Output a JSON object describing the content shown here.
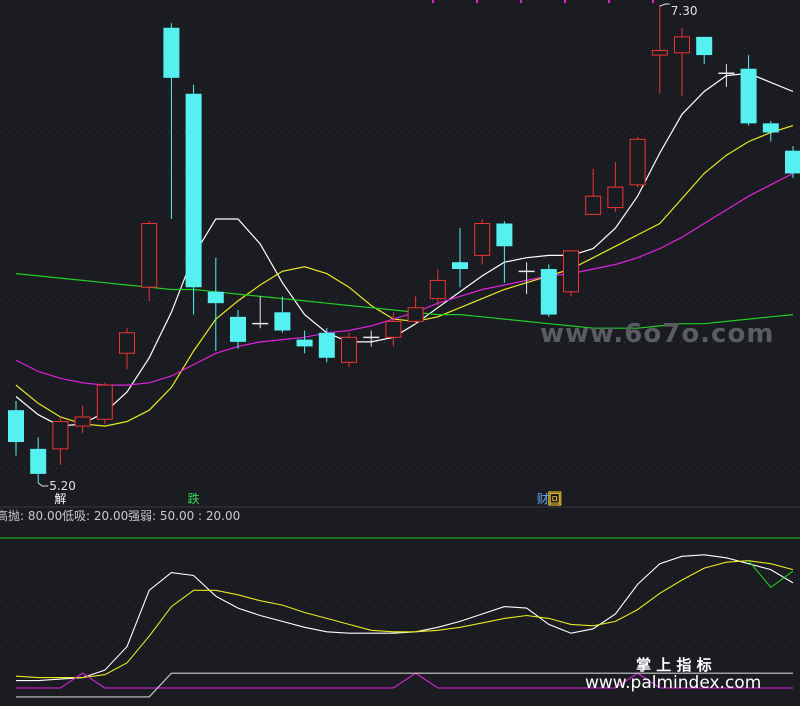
{
  "chart_data": [
    {
      "type": "candlestick",
      "panel": "price",
      "annotations": {
        "high_label": "7.30",
        "low_label": "5.20"
      },
      "event_markers": [
        {
          "index": 2,
          "text": "解"
        },
        {
          "index": 8,
          "text": "跌"
        },
        {
          "index": 24,
          "text": "财"
        },
        {
          "index": 24,
          "text": "回"
        }
      ],
      "candles": [
        {
          "o": 5.52,
          "c": 5.38,
          "h": 5.56,
          "l": 5.32
        },
        {
          "o": 5.35,
          "c": 5.24,
          "h": 5.4,
          "l": 5.2
        },
        {
          "o": 5.35,
          "c": 5.47,
          "h": 5.49,
          "l": 5.28
        },
        {
          "o": 5.45,
          "c": 5.49,
          "h": 5.54,
          "l": 5.42
        },
        {
          "o": 5.48,
          "c": 5.63,
          "h": 5.64,
          "l": 5.46
        },
        {
          "o": 5.77,
          "c": 5.86,
          "h": 5.88,
          "l": 5.7
        },
        {
          "o": 6.06,
          "c": 6.34,
          "h": 6.35,
          "l": 6.0
        },
        {
          "o": 7.2,
          "c": 6.98,
          "h": 7.22,
          "l": 6.36
        },
        {
          "o": 6.91,
          "c": 6.06,
          "h": 6.95,
          "l": 5.94
        },
        {
          "o": 6.04,
          "c": 5.99,
          "h": 6.19,
          "l": 5.78
        },
        {
          "o": 5.93,
          "c": 5.82,
          "h": 5.96,
          "l": 5.79
        },
        {
          "o": 5.9,
          "c": 5.9,
          "h": 6.02,
          "l": 5.88
        },
        {
          "o": 5.95,
          "c": 5.87,
          "h": 6.02,
          "l": 5.86
        },
        {
          "o": 5.83,
          "c": 5.8,
          "h": 5.87,
          "l": 5.77
        },
        {
          "o": 5.86,
          "c": 5.75,
          "h": 5.88,
          "l": 5.73
        },
        {
          "o": 5.73,
          "c": 5.84,
          "h": 5.86,
          "l": 5.71
        },
        {
          "o": 5.84,
          "c": 5.84,
          "h": 5.87,
          "l": 5.8
        },
        {
          "o": 5.84,
          "c": 5.91,
          "h": 5.95,
          "l": 5.8
        },
        {
          "o": 5.91,
          "c": 5.97,
          "h": 6.02,
          "l": 5.9
        },
        {
          "o": 6.01,
          "c": 6.09,
          "h": 6.14,
          "l": 5.98
        },
        {
          "o": 6.17,
          "c": 6.14,
          "h": 6.32,
          "l": 6.06
        },
        {
          "o": 6.2,
          "c": 6.34,
          "h": 6.36,
          "l": 6.16
        },
        {
          "o": 6.34,
          "c": 6.24,
          "h": 6.35,
          "l": 6.08
        },
        {
          "o": 6.13,
          "c": 6.13,
          "h": 6.17,
          "l": 6.03
        },
        {
          "o": 6.14,
          "c": 5.94,
          "h": 6.16,
          "l": 5.93
        },
        {
          "o": 6.04,
          "c": 6.22,
          "h": 6.22,
          "l": 6.02
        },
        {
          "o": 6.38,
          "c": 6.46,
          "h": 6.58,
          "l": 6.38
        },
        {
          "o": 6.41,
          "c": 6.5,
          "h": 6.61,
          "l": 6.39
        },
        {
          "o": 6.51,
          "c": 6.71,
          "h": 6.72,
          "l": 6.5
        },
        {
          "o": 7.08,
          "c": 7.1,
          "h": 7.3,
          "l": 6.91
        },
        {
          "o": 7.09,
          "c": 7.16,
          "h": 7.2,
          "l": 6.9
        },
        {
          "o": 7.16,
          "c": 7.08,
          "h": 7.16,
          "l": 7.04
        },
        {
          "o": 7.0,
          "c": 7.0,
          "h": 7.04,
          "l": 6.94
        },
        {
          "o": 7.02,
          "c": 6.78,
          "h": 7.08,
          "l": 6.77
        },
        {
          "o": 6.78,
          "c": 6.74,
          "h": 6.79,
          "l": 6.7
        },
        {
          "o": 6.66,
          "c": 6.56,
          "h": 6.68,
          "l": 6.54
        }
      ],
      "ma_lines": [
        {
          "color": "#ffffff",
          "values": [
            5.58,
            5.5,
            5.45,
            5.46,
            5.51,
            5.6,
            5.75,
            5.95,
            6.2,
            6.36,
            6.36,
            6.25,
            6.08,
            5.94,
            5.86,
            5.82,
            5.82,
            5.84,
            5.9,
            5.97,
            6.04,
            6.11,
            6.17,
            6.19,
            6.2,
            6.2,
            6.23,
            6.32,
            6.46,
            6.65,
            6.82,
            6.92,
            6.99,
            7.0,
            6.96,
            6.92
          ]
        },
        {
          "color": "#e8e820",
          "values": [
            5.63,
            5.55,
            5.49,
            5.46,
            5.45,
            5.47,
            5.52,
            5.62,
            5.78,
            5.92,
            6.0,
            6.07,
            6.13,
            6.15,
            6.12,
            6.06,
            5.98,
            5.92,
            5.91,
            5.93,
            5.97,
            6.01,
            6.05,
            6.08,
            6.11,
            6.14,
            6.19,
            6.24,
            6.29,
            6.34,
            6.45,
            6.56,
            6.64,
            6.7,
            6.74,
            6.77
          ]
        },
        {
          "color": "#dd22dd",
          "values": [
            5.74,
            5.69,
            5.66,
            5.64,
            5.63,
            5.63,
            5.64,
            5.67,
            5.72,
            5.77,
            5.8,
            5.82,
            5.83,
            5.84,
            5.86,
            5.87,
            5.89,
            5.92,
            5.95,
            5.99,
            6.02,
            6.05,
            6.07,
            6.09,
            6.11,
            6.12,
            6.14,
            6.16,
            6.19,
            6.23,
            6.28,
            6.34,
            6.4,
            6.46,
            6.51,
            6.56
          ]
        },
        {
          "color": "#22cc22",
          "values": [
            6.12,
            6.11,
            6.1,
            6.09,
            6.08,
            6.07,
            6.06,
            6.05,
            6.05,
            6.04,
            6.03,
            6.02,
            6.01,
            6.0,
            5.99,
            5.98,
            5.97,
            5.96,
            5.95,
            5.94,
            5.94,
            5.93,
            5.92,
            5.91,
            5.9,
            5.89,
            5.88,
            5.88,
            5.88,
            5.89,
            5.9,
            5.9,
            5.91,
            5.92,
            5.93,
            5.94
          ]
        }
      ]
    },
    {
      "type": "line",
      "panel": "indicator",
      "legend": [
        {
          "label": "高抛: 80.00",
          "color": "#c8c8c8"
        },
        {
          "label": "低吸: 20.00",
          "color": "#c8c8c8"
        },
        {
          "label": "强弱: 50.00 : 20.00",
          "color": "#c8c8c8"
        }
      ],
      "series": [
        {
          "color": "#ffffff",
          "values": [
            5,
            5,
            6,
            7,
            12,
            28,
            66,
            78,
            76,
            62,
            54,
            49,
            45,
            41,
            38,
            37,
            37,
            37,
            38,
            41,
            45,
            50,
            55,
            54,
            43,
            37,
            40,
            50,
            70,
            84,
            89,
            90,
            88,
            84,
            80,
            71
          ]
        },
        {
          "color": "#e8e820",
          "values": [
            8,
            7,
            7,
            7,
            9,
            17,
            35,
            55,
            66,
            66,
            63,
            59,
            56,
            51,
            47,
            43,
            39,
            38,
            38,
            39,
            41,
            44,
            47,
            49,
            47,
            43,
            42,
            45,
            53,
            64,
            73,
            81,
            85,
            86,
            84,
            80
          ]
        },
        {
          "color": "#22cc22",
          "values": [
            null,
            null,
            null,
            null,
            null,
            null,
            null,
            null,
            null,
            null,
            null,
            null,
            null,
            null,
            null,
            null,
            null,
            null,
            null,
            null,
            null,
            null,
            null,
            null,
            null,
            null,
            null,
            null,
            null,
            null,
            null,
            null,
            null,
            86,
            68,
            79
          ]
        },
        {
          "color": "#dd22dd",
          "values": [
            0,
            0,
            0,
            10,
            0,
            0,
            0,
            0,
            0,
            0,
            0,
            0,
            0,
            0,
            0,
            0,
            0,
            0,
            10,
            0,
            0,
            0,
            0,
            0,
            0,
            0,
            0,
            0,
            10,
            0,
            0,
            0,
            0,
            0,
            0,
            0
          ]
        },
        {
          "color": "#cccccc",
          "values": [
            -6,
            -6,
            -6,
            -6,
            -6,
            -6,
            -6,
            10,
            10,
            10,
            10,
            10,
            10,
            10,
            10,
            10,
            10,
            10,
            10,
            10,
            10,
            10,
            10,
            10,
            10,
            10,
            10,
            10,
            10,
            10,
            10,
            10,
            10,
            10,
            10,
            10
          ]
        }
      ]
    }
  ],
  "watermarks": {
    "top_right": "www.6o7o.com",
    "bottom_cn": "掌 上 指 标",
    "bottom_url": "www.palmindex.com"
  }
}
